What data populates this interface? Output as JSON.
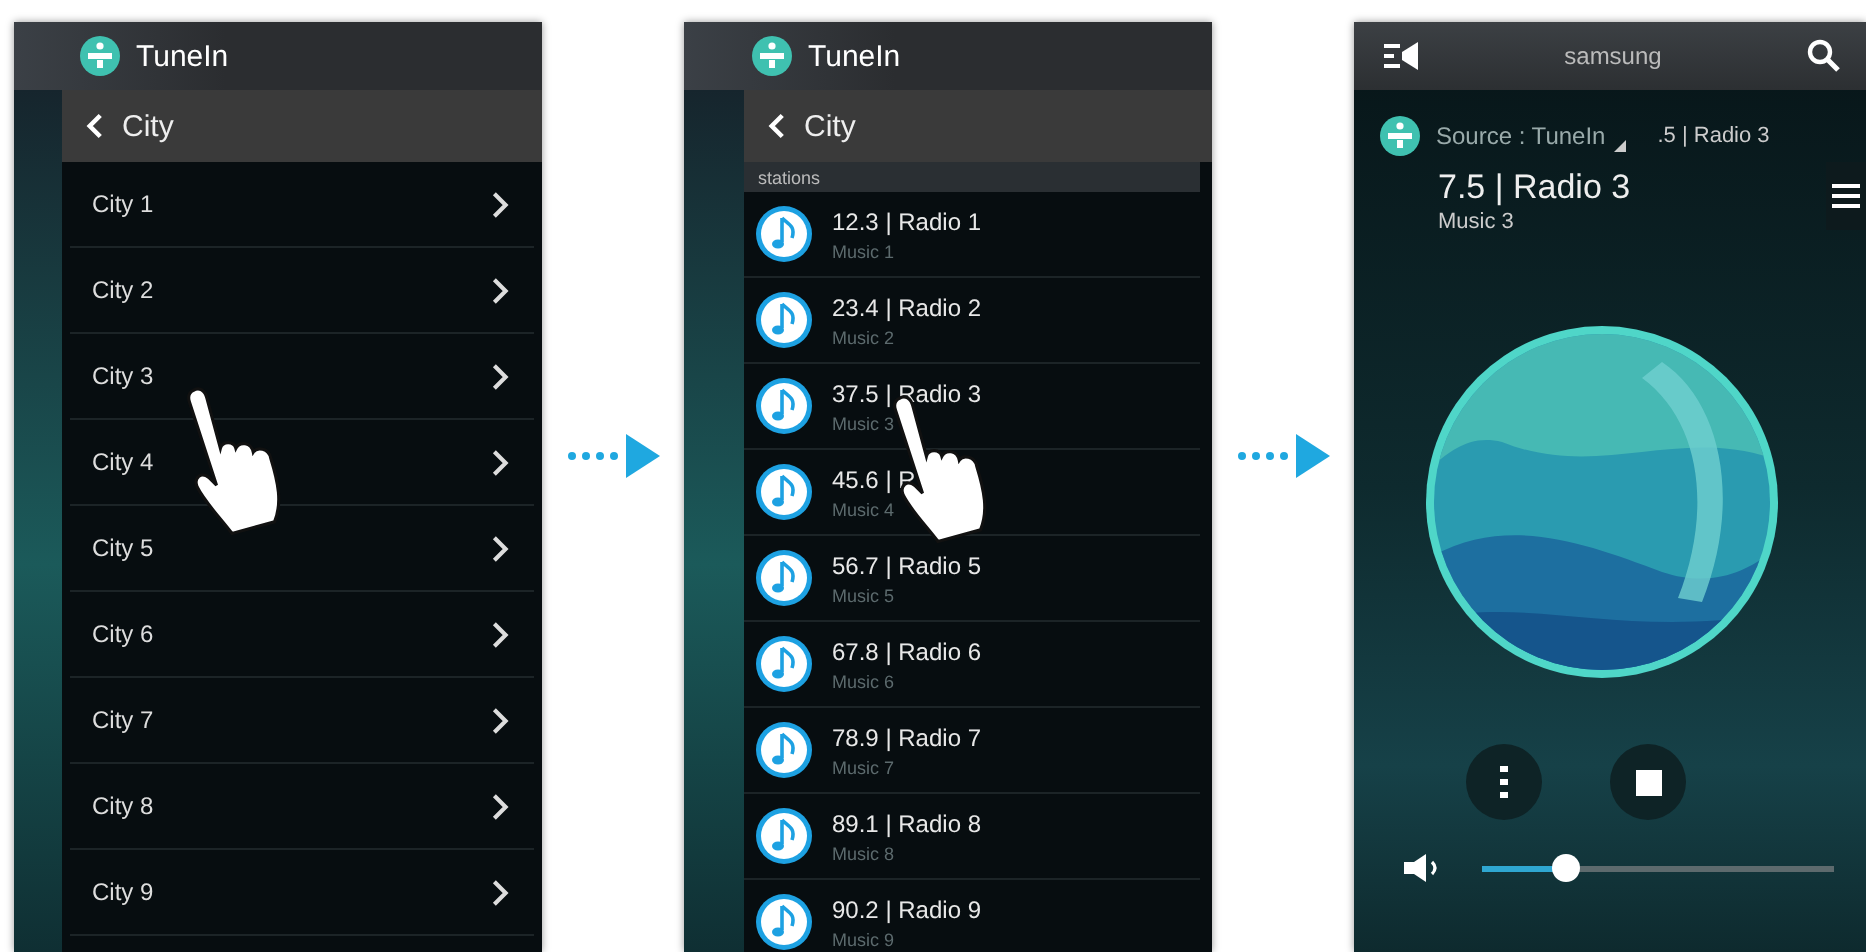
{
  "screens": [
    {
      "kind": "city_list",
      "app_title": "TuneIn",
      "back_title": "City",
      "items": [
        {
          "label": "City 1"
        },
        {
          "label": "City 2"
        },
        {
          "label": "City 3"
        },
        {
          "label": "City 4"
        },
        {
          "label": "City 5"
        },
        {
          "label": "City 6"
        },
        {
          "label": "City 7"
        },
        {
          "label": "City 8"
        },
        {
          "label": "City 9"
        }
      ]
    },
    {
      "kind": "station_list",
      "app_title": "TuneIn",
      "back_title": "City",
      "section": "stations",
      "items": [
        {
          "title": "12.3 | Radio 1",
          "subtitle": "Music 1"
        },
        {
          "title": "23.4 | Radio 2",
          "subtitle": "Music 2"
        },
        {
          "title": "37.5 | Radio 3",
          "subtitle": "Music 3"
        },
        {
          "title": "45.6 | R",
          "subtitle": "Music 4"
        },
        {
          "title": "56.7 | Radio 5",
          "subtitle": "Music 5"
        },
        {
          "title": "67.8 | Radio 6",
          "subtitle": "Music 6"
        },
        {
          "title": "78.9 | Radio 7",
          "subtitle": "Music 7"
        },
        {
          "title": "89.1 | Radio 8",
          "subtitle": "Music 8"
        },
        {
          "title": "90.2 | Radio 9",
          "subtitle": "Music 9"
        }
      ]
    },
    {
      "kind": "player",
      "device": "samsung",
      "source": "Source : TuneIn",
      "ticker": ".5 | Radio 3",
      "title": "7.5 | Radio 3",
      "subtitle": "Music 3",
      "volume": {
        "level": 0.22
      }
    }
  ]
}
